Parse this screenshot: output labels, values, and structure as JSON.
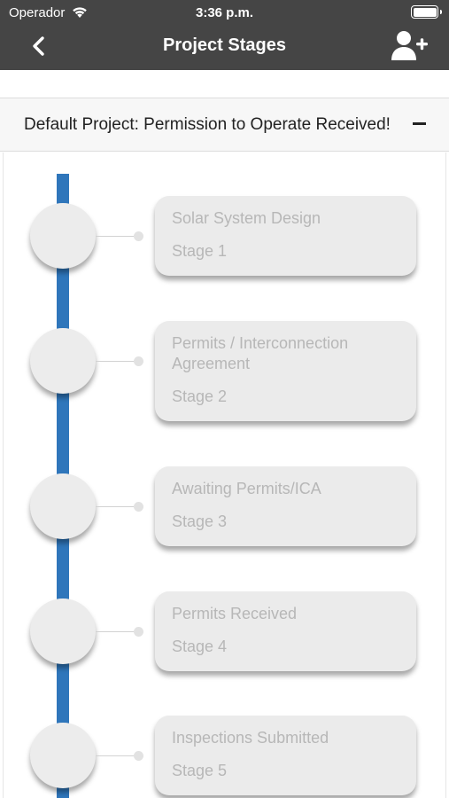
{
  "status_bar": {
    "carrier": "Operador",
    "time": "3:36 p.m."
  },
  "header": {
    "title": "Project Stages",
    "back_icon": "chevron-left-icon",
    "add_user_icon": "add-user-icon"
  },
  "project": {
    "title": "Default Project: Permission to Operate Received!",
    "collapse_icon": "minus-icon"
  },
  "colors": {
    "header_bg": "#454545",
    "timeline": "#2f76bb",
    "card_bg": "#ebebeb",
    "card_text": "#b7b7b7"
  },
  "stages": [
    {
      "name": "Solar System Design",
      "stage": "Stage 1"
    },
    {
      "name": "Permits / Interconnection Agreement",
      "stage": "Stage 2"
    },
    {
      "name": "Awaiting Permits/ICA",
      "stage": "Stage 3"
    },
    {
      "name": "Permits Received",
      "stage": "Stage 4"
    },
    {
      "name": "Inspections Submitted",
      "stage": "Stage 5"
    }
  ]
}
